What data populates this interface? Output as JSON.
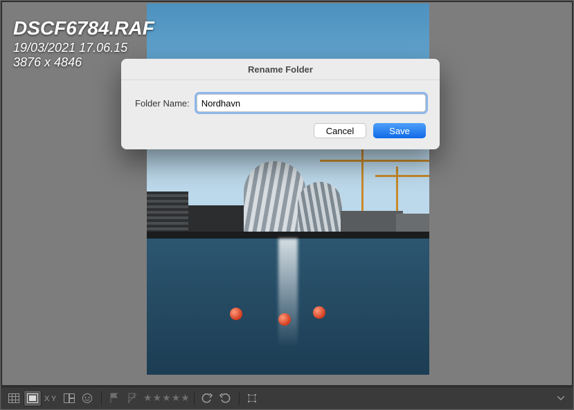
{
  "overlay": {
    "filename": "DSCF6784.RAF",
    "datetime": "19/03/2021 17.06.15",
    "dimensions": "3876 x 4846"
  },
  "dialog": {
    "title": "Rename Folder",
    "field_label": "Folder Name:",
    "value": "Nordhavn",
    "cancel": "Cancel",
    "save": "Save"
  },
  "toolbar": {
    "stars": [
      "★",
      "★",
      "★",
      "★",
      "★"
    ]
  }
}
